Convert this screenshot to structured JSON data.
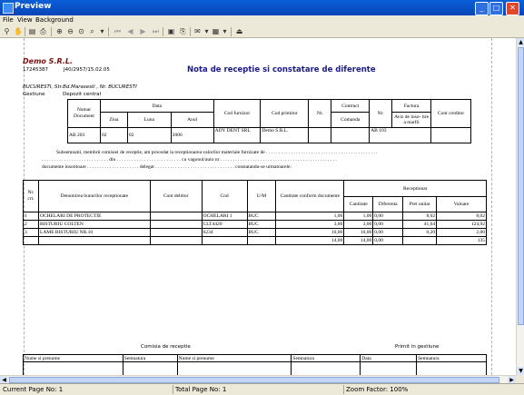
{
  "window": {
    "title": "Preview",
    "min": "_",
    "max": "□",
    "close": "✕"
  },
  "menu": [
    "File",
    "View",
    "Background"
  ],
  "toolbar": {
    "icons": [
      "binoculars-icon",
      "hand-icon",
      "print-setup-icon",
      "print-icon",
      "zoom-in-icon",
      "zoom-out-icon",
      "zoom-width-icon",
      "zoom-custom-icon",
      "first-page-icon",
      "prev-page-icon",
      "next-page-icon",
      "last-page-icon",
      "page-view-icon",
      "export-icon",
      "email-icon",
      "bg-color-icon",
      "exit-icon"
    ]
  },
  "document": {
    "company": "Demo S.R.L.",
    "cif": "17245387",
    "regcom": "J40/2957/15.02.05",
    "address": "BUCURESTI, Str.Bd.Marasesti , Nr.  BUCURESTI",
    "gestiune_label": "Gestiune",
    "gestiune_value": "Depozit central",
    "title": "Nota de receptie si constatare de diferente",
    "header_table": {
      "h_numar": "Numar Document",
      "h_data": "Data",
      "h_ziua": "Ziua",
      "h_luna": "Luna",
      "h_anul": "Anul",
      "h_codfurn": "Cod furnizor",
      "h_codprim": "Cod primitor",
      "h_nr1": "Nr.",
      "h_contract": "Contract",
      "h_comanda": "Comanda",
      "h_nr2": "Nr.",
      "h_factura": "Factura",
      "h_aviz": "Aviz de inso- tire a marfii",
      "h_cont": "Cont creditor",
      "v_numar": "AB 203",
      "v_ziua": "02",
      "v_luna": "02",
      "v_anul": "2006",
      "v_codfurn": "ADY DENT SRL",
      "v_codprim": "Demo S.R.L.",
      "v_nr2": "AB 103"
    },
    "statement": {
      "line1": "Subsemnatii, membrii comisiei de receptie, am procedat la receptionarea valorilor materiale furnizate de",
      "line2a": "din",
      "line2b": "cu vagonul/auto nr",
      "line3a": "documente insotitoare",
      "line3b": "delegat",
      "line3c": "constatandu-se urmatoarele:"
    },
    "items_table": {
      "h_nrcrt": "Nr. crt.",
      "h_denumire": "Denumirea bunurilor receptionate",
      "h_cont_debitor": "Cont debitor",
      "h_cod": "Cod",
      "h_um": "U/M",
      "h_cant_doc": "Cantitate conform documente",
      "h_receptionat": "Receptionat",
      "h_cantitate": "Cantitate",
      "h_diferenta": "Diferenta",
      "h_pret": "Pret unitar",
      "h_valoare": "Valoare",
      "rows": [
        {
          "nr": "1",
          "den": "OCHELARI DE PROTECTIE",
          "cont": "",
          "cod": "OCHELARI 1",
          "um": "BUC",
          "doc": "1,00",
          "cant": "1,00",
          "dif": "0,00",
          "pret": "8,02",
          "val": "8,02"
        },
        {
          "nr": "2",
          "den": "BISTURIU COLTEN",
          "cont": "",
          "cod": "CLT4420",
          "um": "BUC",
          "doc": "3,00",
          "cant": "3,00",
          "dif": "0,00",
          "pret": "41,64",
          "val": "124,92"
        },
        {
          "nr": "3",
          "den": "LAME BISTURIU NR.10",
          "cont": "",
          "cod": "6234",
          "um": "BUC",
          "doc": "10,00",
          "cant": "10,00",
          "dif": "0,00",
          "pret": "0,20",
          "val": "2,00"
        }
      ],
      "total": {
        "doc": "14,00",
        "cant": "14,00",
        "dif": "0,00",
        "val": "135"
      }
    },
    "footer": {
      "comisia": "Comisia de receptie",
      "primit": "Primit in gestiune",
      "nume1": "Nume si prenume",
      "semn1": "Semnatura",
      "nume2": "Nume si prenume",
      "semn2": "Semnatura",
      "data": "Data",
      "semn3": "Semnatura"
    }
  },
  "status": {
    "current": "Current Page No: 1",
    "total": "Total Page No: 1",
    "zoom": "Zoom Factor: 100%"
  }
}
